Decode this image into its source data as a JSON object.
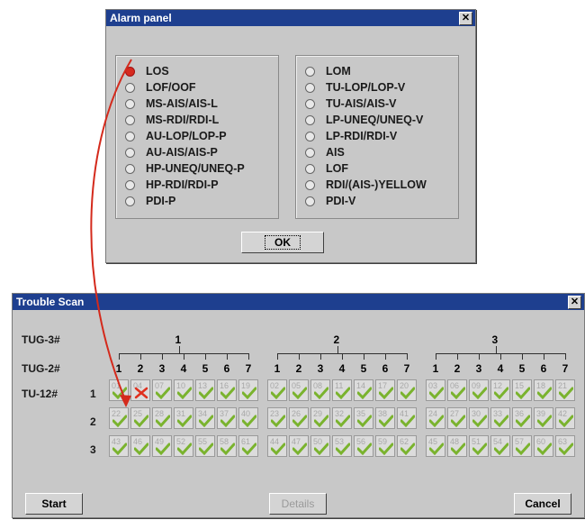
{
  "alarm_panel": {
    "title": "Alarm panel",
    "left_options": [
      "LOS",
      "LOF/OOF",
      "MS-AIS/AIS-L",
      "MS-RDI/RDI-L",
      "AU-LOP/LOP-P",
      "AU-AIS/AIS-P",
      "HP-UNEQ/UNEQ-P",
      "HP-RDI/RDI-P",
      "PDI-P"
    ],
    "right_options": [
      "LOM",
      "TU-LOP/LOP-V",
      "TU-AIS/AIS-V",
      "LP-UNEQ/UNEQ-V",
      "LP-RDI/RDI-V",
      "AIS",
      "LOF",
      "RDI/(AIS-)YELLOW",
      "PDI-V"
    ],
    "selected": "LOS",
    "ok_label": "OK"
  },
  "trouble_scan": {
    "title": "Trouble Scan",
    "tug3_label": "TUG-3#",
    "tug2_label": "TUG-2#",
    "tu12_label": "TU-12#",
    "tug3_numbers": [
      "1",
      "2",
      "3"
    ],
    "tug2_numbers": [
      "1",
      "2",
      "3",
      "4",
      "5",
      "6",
      "7"
    ],
    "row_numbers": [
      "1",
      "2",
      "3"
    ],
    "rows": [
      [
        "01",
        "04",
        "07",
        "10",
        "13",
        "16",
        "19",
        "02",
        "05",
        "08",
        "11",
        "14",
        "17",
        "20",
        "03",
        "06",
        "09",
        "12",
        "15",
        "18",
        "21"
      ],
      [
        "22",
        "25",
        "28",
        "31",
        "34",
        "37",
        "40",
        "23",
        "26",
        "29",
        "32",
        "35",
        "38",
        "41",
        "24",
        "27",
        "30",
        "33",
        "36",
        "39",
        "42"
      ],
      [
        "43",
        "46",
        "49",
        "52",
        "55",
        "58",
        "61",
        "44",
        "47",
        "50",
        "53",
        "56",
        "59",
        "62",
        "45",
        "48",
        "51",
        "54",
        "57",
        "60",
        "63"
      ]
    ],
    "alarm_cell": "04",
    "start_label": "Start",
    "details_label": "Details",
    "cancel_label": "Cancel"
  },
  "colors": {
    "ok_check": "#7ab32e",
    "alarm_mark": "#e0301e",
    "arrow": "#d42a1c"
  },
  "icons": {
    "ok": "check-icon",
    "alarm": "cross-icon"
  }
}
